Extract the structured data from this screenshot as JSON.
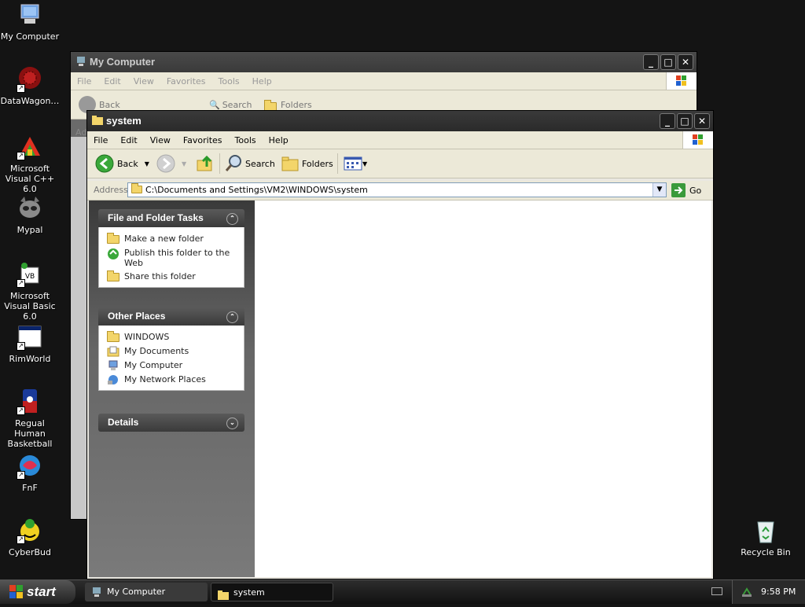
{
  "desktop": {
    "icons": [
      {
        "label": "My Computer",
        "icon": "my-computer-icon"
      },
      {
        "label": "DataWagon…",
        "icon": "datawagon-icon"
      },
      {
        "label": "Microsoft Visual C++ 6.0",
        "icon": "visual-cpp-icon"
      },
      {
        "label": "Mypal",
        "icon": "mypal-icon"
      },
      {
        "label": "Microsoft Visual Basic 6.0",
        "icon": "visual-basic-icon"
      },
      {
        "label": "RimWorld",
        "icon": "rimworld-icon"
      },
      {
        "label": "Regual Human Basketball",
        "icon": "basketball-icon"
      },
      {
        "label": "FnF",
        "icon": "fnf-icon"
      },
      {
        "label": "CyberBud",
        "icon": "cyberbud-icon"
      },
      {
        "label": "Recycle Bin",
        "icon": "recycle-bin-icon"
      }
    ]
  },
  "back_window": {
    "title": "My Computer",
    "menu": [
      "File",
      "Edit",
      "View",
      "Favorites",
      "Tools",
      "Help"
    ],
    "toolbar": {
      "back": "Back",
      "search": "Search",
      "folders": "Folders"
    },
    "address_fragment": "Ad"
  },
  "front_window": {
    "title": "system",
    "menu": [
      "File",
      "Edit",
      "View",
      "Favorites",
      "Tools",
      "Help"
    ],
    "toolbar": {
      "back": "Back",
      "search": "Search",
      "folders": "Folders"
    },
    "address": {
      "label": "Address",
      "value": "C:\\Documents and Settings\\VM2\\WINDOWS\\system",
      "go": "Go"
    },
    "panels": {
      "file_tasks": {
        "title": "File and Folder Tasks",
        "items": [
          "Make a new folder",
          "Publish this folder to the Web",
          "Share this folder"
        ]
      },
      "other_places": {
        "title": "Other Places",
        "items": [
          "WINDOWS",
          "My Documents",
          "My Computer",
          "My Network Places"
        ]
      },
      "details": {
        "title": "Details"
      }
    }
  },
  "taskbar": {
    "start": "start",
    "tasks": [
      "My Computer",
      "system"
    ],
    "clock": "9:58 PM"
  },
  "colors": {
    "desktop": "#141414",
    "titlebar": "#2e2e2e",
    "go_arrow": "#3a9a3a"
  }
}
